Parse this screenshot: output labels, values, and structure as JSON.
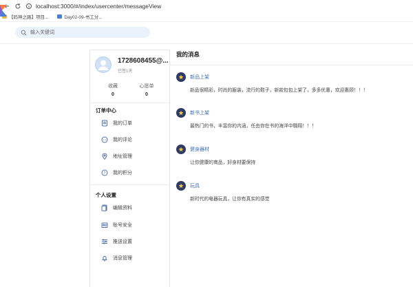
{
  "browser": {
    "address": "localhost:3000/#/index/usercenter/messageView",
    "bookmarks": [
      "【码神之路】项目...",
      "Day02-09-书工分..."
    ]
  },
  "header": {
    "search_placeholder": "输入关键词"
  },
  "user": {
    "name": "1728608455@...",
    "status": "已签1天",
    "stats": [
      {
        "label": "收藏",
        "value": "0"
      },
      {
        "label": "心愿单",
        "value": "0"
      }
    ]
  },
  "sidebar": {
    "order_section": {
      "title": "订单中心",
      "items": [
        {
          "label": "我的订单",
          "icon": "orders-icon"
        },
        {
          "label": "我的评论",
          "icon": "comment-icon"
        },
        {
          "label": "地址管理",
          "icon": "location-icon"
        },
        {
          "label": "我的积分",
          "icon": "points-icon"
        }
      ]
    },
    "personal_section": {
      "title": "个人设置",
      "items": [
        {
          "label": "编辑资料",
          "icon": "edit-profile-icon"
        },
        {
          "label": "账号安全",
          "icon": "security-icon"
        },
        {
          "label": "推送设置",
          "icon": "settings-sliders-icon"
        },
        {
          "label": "消息管理",
          "icon": "bell-icon"
        }
      ]
    }
  },
  "main": {
    "title": "我的消息",
    "messages": [
      {
        "title": "新品上架",
        "body": "新品很精彩，时尚的服装，流行的鞋子，新款包包上架了，多多优惠，欢迎惠顾！！！"
      },
      {
        "title": "新书上架",
        "body": "最热门的书，丰富你的内涵，任由你在书的海洋中翱翔！！！"
      },
      {
        "title": "健身器材",
        "body": "让你健康的商品，好身材要保持"
      },
      {
        "title": "玩具",
        "body": "新时代的电器玩具，让你有真实的感觉"
      }
    ]
  },
  "colors": {
    "accent": "#3b6fb5",
    "badge": "#2f3b63",
    "search_bg": "#eaf2fb"
  }
}
